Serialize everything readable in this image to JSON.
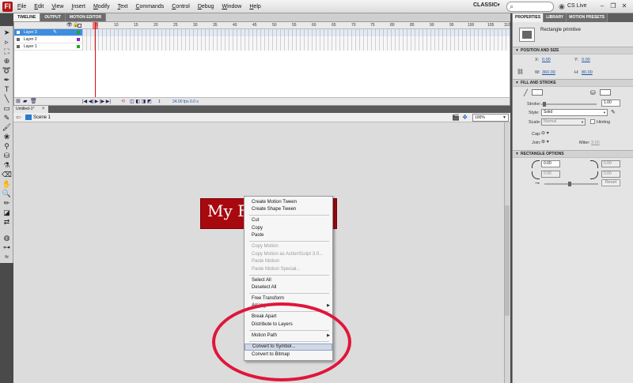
{
  "menubar": {
    "items": [
      "File",
      "Edit",
      "View",
      "Insert",
      "Modify",
      "Text",
      "Commands",
      "Control",
      "Debug",
      "Window",
      "Help"
    ],
    "workspace": "CLASSIC",
    "cs_live": "CS Live"
  },
  "timeline": {
    "tabs": [
      "TIMELINE",
      "OUTPUT",
      "MOTION EDITOR"
    ],
    "layers": [
      "Layer 3",
      "Layer 2",
      "Layer 1"
    ],
    "ruler": [
      "5",
      "10",
      "15",
      "20",
      "25",
      "30",
      "35",
      "40",
      "45",
      "50",
      "55",
      "60",
      "65",
      "70",
      "75",
      "80",
      "85",
      "90",
      "95",
      "100",
      "105",
      "110"
    ],
    "frame": "1",
    "fps": "24.00 fps",
    "time": "0.0 s"
  },
  "document": {
    "tab": "Untitled-1*",
    "scene": "Scene 1",
    "zoom": "100%"
  },
  "stage": {
    "rect_text": "My F",
    "rect_color": "#a8090f"
  },
  "context_menu": {
    "items": [
      {
        "label": "Create Motion Tween"
      },
      {
        "label": "Create Shape Tween"
      },
      {
        "label": "Cut"
      },
      {
        "label": "Copy"
      },
      {
        "label": "Paste"
      },
      {
        "label": "Copy Motion"
      },
      {
        "label": "Copy Motion as ActionScript 3.0..."
      },
      {
        "label": "Paste Motion"
      },
      {
        "label": "Paste Motion Special..."
      },
      {
        "label": "Select All"
      },
      {
        "label": "Deselect All"
      },
      {
        "label": "Free Transform"
      },
      {
        "label": "Arrange"
      },
      {
        "label": "Break Apart"
      },
      {
        "label": "Distribute to Layers"
      },
      {
        "label": "Motion Path"
      },
      {
        "label": "Convert to Symbol..."
      },
      {
        "label": "Convert to Bitmap"
      }
    ]
  },
  "properties": {
    "tabs": [
      "PROPERTIES",
      "LIBRARY",
      "MOTION PRESETS"
    ],
    "object": "Rectangle primitive",
    "position_size": {
      "header": "POSITION AND SIZE",
      "x_label": "X:",
      "x": "0.00",
      "y_label": "Y:",
      "y": "0.00",
      "w_label": "W:",
      "w": "360.00",
      "h_label": "H:",
      "h": "80.00"
    },
    "fill_stroke": {
      "header": "FILL AND STROKE",
      "stroke_label": "Stroke:",
      "stroke": "1.00",
      "style_label": "Style:",
      "style": "Solid",
      "scale_label": "Scale:",
      "scale": "Normal",
      "hinting": "Hinting",
      "cap_label": "Cap:",
      "join_label": "Join:",
      "miter_label": "Miter:",
      "miter": "3.00"
    },
    "rect_options": {
      "header": "RECTANGLE OPTIONS",
      "tl": "0.00",
      "tr": "0.00",
      "bl": "0.00",
      "br": "0.00",
      "reset": "Reset"
    }
  }
}
